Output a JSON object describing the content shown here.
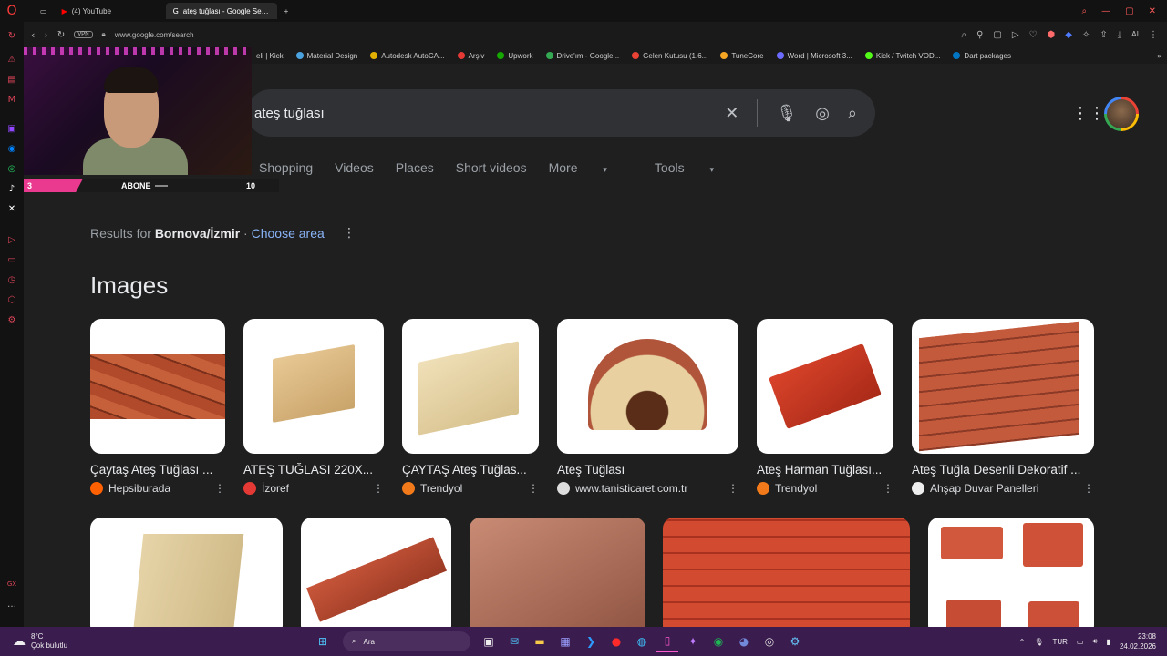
{
  "browser": {
    "tabs": [
      {
        "label": "(4) YouTube",
        "active": false
      },
      {
        "label": "ateş tuğlası - Google Search",
        "active": true
      }
    ],
    "new_tab": "+",
    "vpn": "VPN",
    "url": "www.google.com/search",
    "ai_label": "AI",
    "bookmarks": [
      "eli | Kick",
      "Material Design",
      "Autodesk AutoCA...",
      "Arşiv",
      "Upwork",
      "Drive'ım - Google...",
      "Gelen Kutusu (1.6...",
      "TuneCore",
      "Word | Microsoft 3...",
      "Kick / Twitch VOD...",
      "Dart packages"
    ],
    "sidebar_badge": "GX"
  },
  "stream_overlay": {
    "subscriber_left": "3",
    "label": "ABONE",
    "subscriber_right": "10"
  },
  "google": {
    "query": "ateş tuğlası",
    "nav_tabs": [
      "Shopping",
      "Videos",
      "Places",
      "Short videos",
      "More",
      "Tools"
    ],
    "results_for_prefix": "Results for",
    "location": "Bornova/İzmir",
    "choose_area": "Choose area",
    "images_heading": "Images",
    "images": [
      {
        "title": "Çaytaş Ateş Tuğlası ...",
        "source": "Hepsiburada",
        "fav_color": "#ff6000"
      },
      {
        "title": "ATEŞ TUĞLASI 220X...",
        "source": "İzoref",
        "fav_color": "#e53935"
      },
      {
        "title": "ÇAYTAŞ Ateş Tuğlas...",
        "source": "Trendyol",
        "fav_color": "#f27a1a"
      },
      {
        "title": "Ateş Tuğlası",
        "source": "www.tanisticaret.com.tr",
        "fav_color": "#dddddd"
      },
      {
        "title": "Ateş Harman Tuğlası...",
        "source": "Trendyol",
        "fav_color": "#f27a1a"
      },
      {
        "title": "Ateş Tuğla Desenli Dekoratif ...",
        "source": "Ahşap Duvar Panelleri",
        "fav_color": "#eeeeee"
      }
    ]
  },
  "taskbar": {
    "temperature": "8°C",
    "weather": "Çok bulutlu",
    "search_placeholder": "Ara",
    "lang": "TUR",
    "time": "23:08",
    "date": "24.02.2026"
  }
}
